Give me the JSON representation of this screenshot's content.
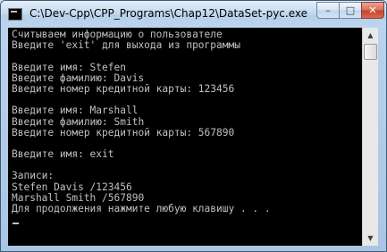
{
  "window": {
    "title": "C:\\Dev-Cpp\\CPP_Programs\\Chap12\\DataSet-pyc.exe",
    "icon": "console-app-icon",
    "controls": {
      "minimize": "–",
      "maximize": "□",
      "close": "✕"
    }
  },
  "console": {
    "background": "#000000",
    "foreground": "#c0c0c0",
    "lines": [
      "Считываем информацию о пользователе",
      "Введите 'exit' для выхода из программы",
      "",
      "Введите имя: Stefen",
      "Введите фамилию: Davis",
      "Введите номер кредитной карты: 123456",
      "",
      "Введите имя: Marshall",
      "Введите фамилию: Smith",
      "Введите номер кредитной карты: 567890",
      "",
      "Введите имя: exit",
      "",
      "Записи:",
      "Stefen Davis /123456",
      "Marshall Smith /567890",
      "Для продолжения нажмите любую клавишу . . ."
    ]
  },
  "scrollbar": {
    "up_arrow": "▲",
    "down_arrow": "▼"
  }
}
